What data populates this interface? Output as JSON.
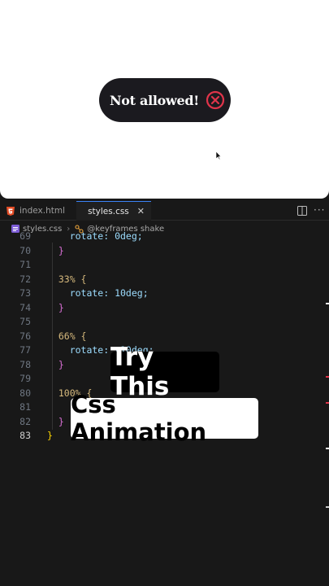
{
  "preview": {
    "toast_text": "Not allowed!",
    "toast_icon": "x-circle-icon",
    "accent_color": "#e0344a"
  },
  "tabs": [
    {
      "label": "index.html",
      "icon": "html5-icon",
      "active": false
    },
    {
      "label": "styles.css",
      "icon": "css-file-icon",
      "active": true,
      "close": "✕"
    }
  ],
  "breadcrumbs": {
    "file": "styles.css",
    "symbol": "@keyframes shake"
  },
  "code_lines": [
    {
      "n": "69",
      "text": "    rotate: 0deg;"
    },
    {
      "n": "70",
      "text": "  }"
    },
    {
      "n": "71",
      "text": ""
    },
    {
      "n": "72",
      "text": "  33% {"
    },
    {
      "n": "73",
      "text": "    rotate: 10deg;"
    },
    {
      "n": "74",
      "text": "  }"
    },
    {
      "n": "75",
      "text": ""
    },
    {
      "n": "76",
      "text": "  66% {"
    },
    {
      "n": "77",
      "text": "    rotate: -10deg;"
    },
    {
      "n": "78",
      "text": "  }"
    },
    {
      "n": "79",
      "text": ""
    },
    {
      "n": "80",
      "text": "  100% {"
    },
    {
      "n": "81",
      "text": ""
    },
    {
      "n": "82",
      "text": "  }"
    },
    {
      "n": "83",
      "text": "}"
    }
  ],
  "captions": {
    "line1": "Try This",
    "line2": "Css Animation"
  }
}
